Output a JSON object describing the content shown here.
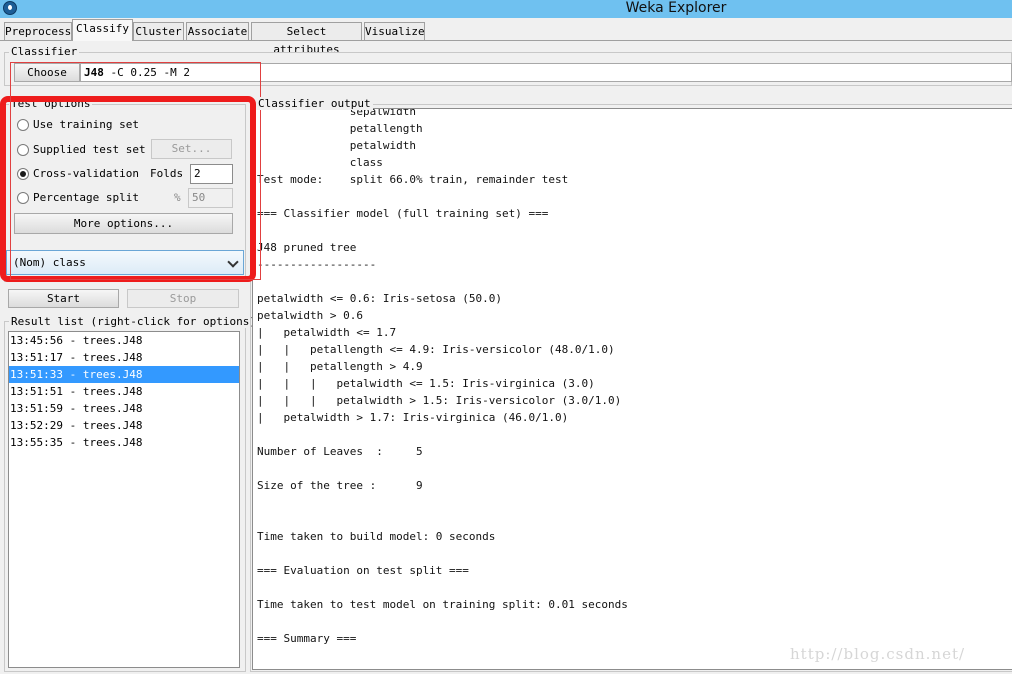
{
  "window": {
    "title": "Weka Explorer"
  },
  "tabs": [
    {
      "label": "Preprocess"
    },
    {
      "label": "Classify"
    },
    {
      "label": "Cluster"
    },
    {
      "label": "Associate"
    },
    {
      "label": "Select attributes"
    },
    {
      "label": "Visualize"
    }
  ],
  "active_tab": "Classify",
  "classifier": {
    "group_label": "Classifier",
    "choose_label": "Choose",
    "name": "J48",
    "options": "-C 0.25 -M 2"
  },
  "test_options": {
    "group_label": "Test options",
    "use_training_set": "Use training set",
    "supplied_test_set": "Supplied test set",
    "set_button": "Set...",
    "cross_validation": "Cross-validation",
    "folds_label": "Folds",
    "folds_value": "2",
    "percentage_split": "Percentage split",
    "percent_symbol": "%",
    "percent_value": "50",
    "more_options": "More options...",
    "selected": "Cross-validation"
  },
  "class_selector": {
    "value": "(Nom) class"
  },
  "actions": {
    "start": "Start",
    "stop": "Stop"
  },
  "result_list": {
    "label": "Result list (right-click for options)",
    "items": [
      "13:45:56 - trees.J48",
      "13:51:17 - trees.J48",
      "13:51:33 - trees.J48",
      "13:51:51 - trees.J48",
      "13:51:59 - trees.J48",
      "13:52:29 - trees.J48",
      "13:55:35 - trees.J48"
    ],
    "selected_index": 2
  },
  "output": {
    "label": "Classifier output",
    "lines": [
      "              sepalwidth",
      "              petallength",
      "              petalwidth",
      "              class",
      "Test mode:    split 66.0% train, remainder test",
      "",
      "=== Classifier model (full training set) ===",
      "",
      "J48 pruned tree",
      "------------------",
      "",
      "petalwidth <= 0.6: Iris-setosa (50.0)",
      "petalwidth > 0.6",
      "|   petalwidth <= 1.7",
      "|   |   petallength <= 4.9: Iris-versicolor (48.0/1.0)",
      "|   |   petallength > 4.9",
      "|   |   |   petalwidth <= 1.5: Iris-virginica (3.0)",
      "|   |   |   petalwidth > 1.5: Iris-versicolor (3.0/1.0)",
      "|   petalwidth > 1.7: Iris-virginica (46.0/1.0)",
      "",
      "Number of Leaves  :     5",
      "",
      "Size of the tree :      9",
      "",
      "",
      "Time taken to build model: 0 seconds",
      "",
      "=== Evaluation on test split ===",
      "",
      "Time taken to test model on training split: 0.01 seconds",
      "",
      "=== Summary ==="
    ]
  },
  "watermark": "http://blog.csdn.net/",
  "colors": {
    "titlebar": "#6fc1f0",
    "selection": "#3399ff",
    "annotation": "#ee1c1c"
  }
}
